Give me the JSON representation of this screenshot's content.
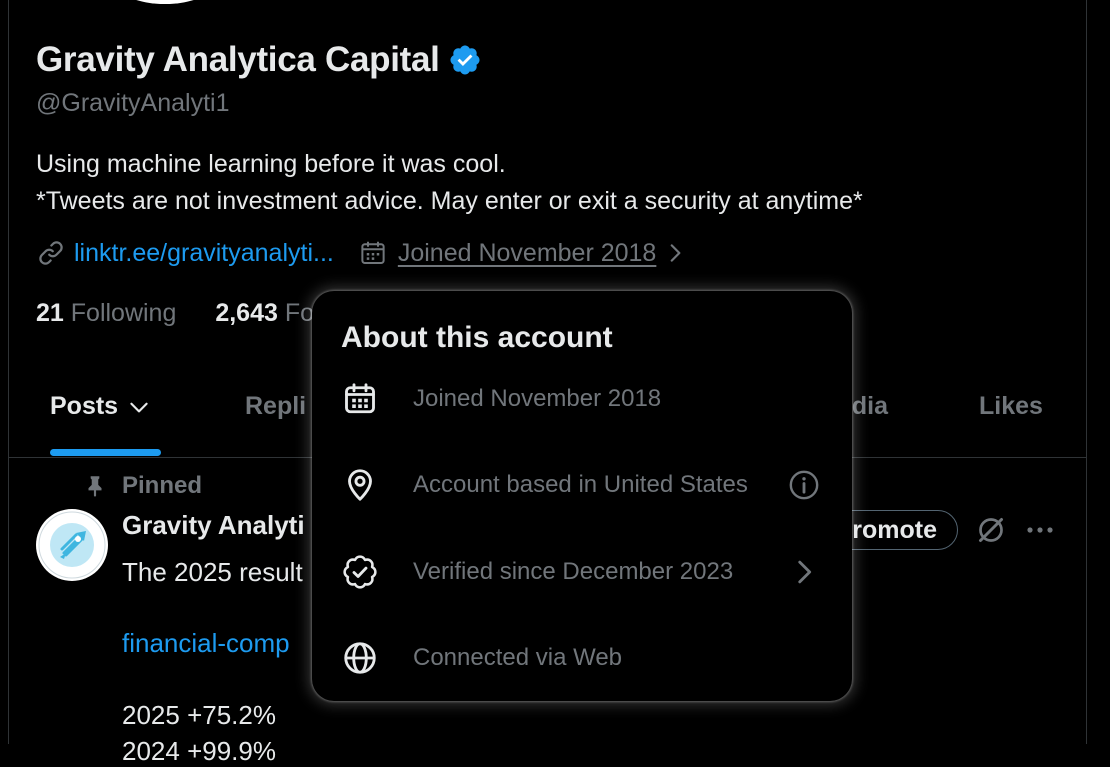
{
  "profile": {
    "name": "Gravity Analytica Capital",
    "handle": "@GravityAnalyti1",
    "bio_line1": "Using machine learning before it was cool.",
    "bio_line2": "*Tweets are not investment advice. May enter or exit a security at anytime*",
    "link": "linktr.ee/gravityanalyti...",
    "joined": "Joined November 2018",
    "following_count": "21",
    "following_label": "Following",
    "followers_count": "2,643",
    "followers_label": "Fo"
  },
  "tabs": {
    "posts": "Posts",
    "replies": "Repli",
    "media": "edia",
    "likes": "Likes"
  },
  "post": {
    "pinned_label": "Pinned",
    "author": "Gravity Analyti",
    "text": "The 2025 result",
    "link": "financial-comp",
    "line_2025": "2025 +75.2%",
    "line_next": "2024 +99.9%",
    "promote_label": "romote"
  },
  "popup": {
    "title": "About this account",
    "rows": [
      {
        "icon": "calendar-icon",
        "label": "Joined November 2018"
      },
      {
        "icon": "location-pin-icon",
        "label": "Account based in United States"
      },
      {
        "icon": "verified-badge-icon",
        "label": "Verified since December 2023"
      },
      {
        "icon": "globe-icon",
        "label": "Connected via Web"
      }
    ]
  },
  "colors": {
    "accent": "#1d9bf0",
    "muted": "#71767b",
    "text": "#e7e9ea",
    "background": "#000000"
  }
}
